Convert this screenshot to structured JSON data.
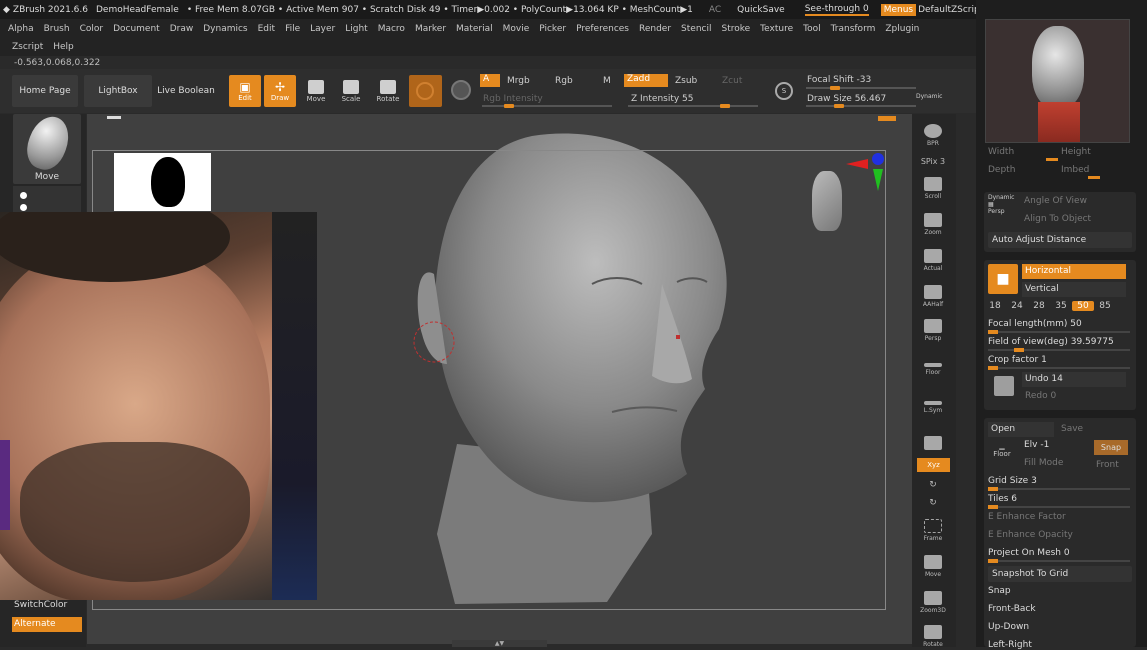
{
  "titlebar": {
    "app": "ZBrush 2021.6.6",
    "doc": "DemoHeadFemale",
    "stats": "• Free Mem 8.07GB • Active Mem 907 • Scratch Disk 49 • Timer▶0.002 • PolyCount▶13.064 KP • MeshCount▶1",
    "ac": "AC",
    "quicksave": "QuickSave",
    "seethrough": "See-through 0",
    "menus": "Menus",
    "script": "DefaultZScript"
  },
  "menu": [
    "Alpha",
    "Brush",
    "Color",
    "Document",
    "Draw",
    "Dynamics",
    "Edit",
    "File",
    "Layer",
    "Light",
    "Macro",
    "Marker",
    "Material",
    "Movie",
    "Picker",
    "Preferences",
    "Render",
    "Stencil",
    "Stroke",
    "Texture",
    "Tool",
    "Transform",
    "Zplugin"
  ],
  "menu2": [
    "Zscript",
    "Help"
  ],
  "coords": "-0.563,0.068,0.322",
  "shelf": {
    "home": "Home Page",
    "lightbox": "LightBox",
    "liveboolean": "Live Boolean",
    "edit": "Edit",
    "draw": "Draw",
    "move": "Move",
    "scale": "Scale",
    "rotate": "Rotate",
    "a": "A",
    "mrgb": "Mrgb",
    "rgb": "Rgb",
    "m": "M",
    "rgbint": "Rgb Intensity",
    "zadd": "Zadd",
    "zsub": "Zsub",
    "zcut": "Zcut",
    "zint": "Z Intensity 55",
    "focal": "Focal Shift -33",
    "drawsize": "Draw Size 56.467",
    "dynamic": "Dynamic"
  },
  "left": {
    "brush": "Move",
    "switchcolor": "SwitchColor",
    "alternate": "Alternate"
  },
  "rshelf": [
    "BPR",
    "SPix 3",
    "Scroll",
    "Zoom",
    "Actual",
    "AAHalf",
    "Persp",
    "Floor",
    "L.Sym",
    "",
    "Xyz",
    "",
    "",
    "Frame",
    "Move",
    "Zoom3D",
    "Rotate"
  ],
  "rpanel": {
    "width": "Width",
    "height": "Height",
    "depth": "Depth",
    "imbed": "Imbed",
    "dynamic": "Dynamic",
    "persp": "Persp",
    "angle": "Angle Of View",
    "align": "Align To Object",
    "autoadjust": "Auto Adjust Distance",
    "horizontal": "Horizontal",
    "vertical": "Vertical",
    "focals": [
      "18",
      "24",
      "28",
      "35",
      "50",
      "85"
    ],
    "focallength": "Focal length(mm) 50",
    "fov": "Field of view(deg) 39.59775",
    "crop": "Crop factor 1",
    "undo": "Undo 14",
    "redo": "Redo 0",
    "open": "Open",
    "save": "Save",
    "elv": "Elv -1",
    "snap": "Snap",
    "floor": "Floor",
    "fillmode": "Fill Mode",
    "front": "Front",
    "gridsize": "Grid Size 3",
    "tiles": "Tiles 6",
    "enhfactor": "E Enhance Factor",
    "enhopacity": "E Enhance Opacity",
    "projmesh": "Project On Mesh 0",
    "snapshot": "Snapshot To Grid",
    "snap2": "Snap",
    "frontback": "Front-Back",
    "updown": "Up-Down",
    "leftright": "Left-Right"
  }
}
